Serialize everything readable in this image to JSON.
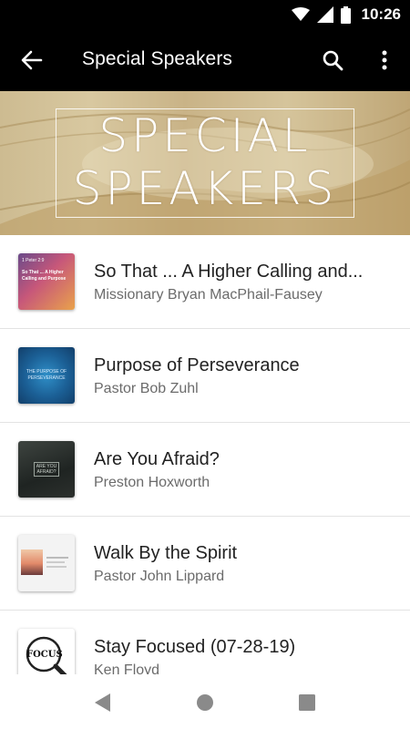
{
  "status_bar": {
    "time": "10:26"
  },
  "app_bar": {
    "title": "Special Speakers"
  },
  "banner": {
    "line1": "SPECIAL",
    "line2": "SPEAKERS"
  },
  "items": [
    {
      "title": "So That ... A Higher Calling and...",
      "subtitle": "Missionary Bryan MacPhail-Fausey",
      "thumb_text": [
        "1 Peter 2:9",
        "So That ... A Higher",
        "Calling and Purpose"
      ]
    },
    {
      "title": "Purpose of Perseverance",
      "subtitle": "Pastor Bob Zuhl",
      "thumb_text": [
        "THE PURPOSE OF",
        "PERSEVERANCE"
      ]
    },
    {
      "title": "Are You Afraid?",
      "subtitle": "Preston Hoxworth",
      "thumb_text": [
        "ARE YOU",
        "AFRAID?"
      ]
    },
    {
      "title": "Walk By the Spirit",
      "subtitle": "Pastor John Lippard",
      "thumb_text": []
    },
    {
      "title": "Stay Focused (07-28-19)",
      "subtitle": "Ken Floyd",
      "thumb_text": [
        "FOCUS"
      ]
    }
  ],
  "colors": {
    "bar": "#000000",
    "title_text": "#222222",
    "subtitle_text": "#6b6b6b",
    "divider": "#e3e3e3"
  },
  "icons": {
    "back": "arrow-left-icon",
    "search": "search-icon",
    "more": "more-vertical-icon",
    "nav_back": "triangle-back-icon",
    "nav_home": "circle-home-icon",
    "nav_recents": "square-recents-icon"
  }
}
